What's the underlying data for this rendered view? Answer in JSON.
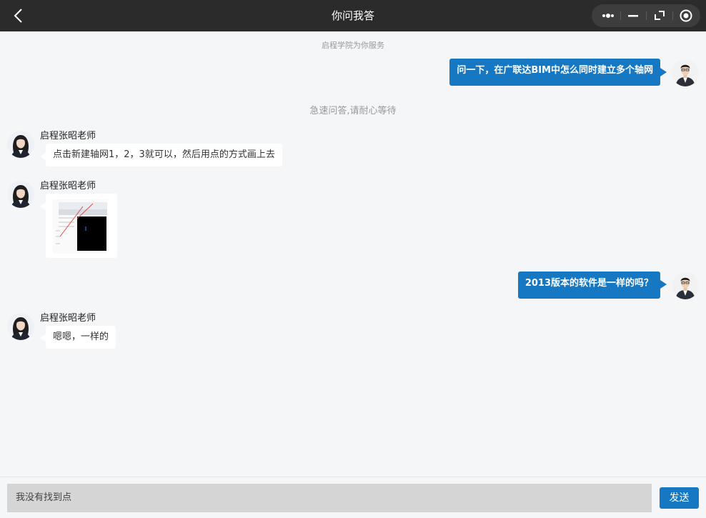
{
  "header": {
    "title": "你问我答"
  },
  "chat": {
    "system_top": "启程学院为你服务",
    "system_notice": "急速问答,请耐心等待",
    "messages": [
      {
        "from": "user",
        "text": "问一下，在广联达BIM中怎么同时建立多个轴网"
      },
      {
        "from": "teacher",
        "name": "启程张昭老师",
        "text": "点击新建轴网1，2，3就可以，然后用点的方式画上去"
      },
      {
        "from": "teacher",
        "name": "启程张昭老师",
        "type": "image"
      },
      {
        "from": "user",
        "text": "2013版本的软件是一样的吗？"
      },
      {
        "from": "teacher",
        "name": "启程张昭老师",
        "text": "嗯嗯，一样的"
      }
    ]
  },
  "composer": {
    "input_value": "我没有找到点",
    "send_label": "发送"
  },
  "colors": {
    "header_bg": "#2b2b2b",
    "accent": "#1677c3",
    "background": "#f4f6f8"
  }
}
